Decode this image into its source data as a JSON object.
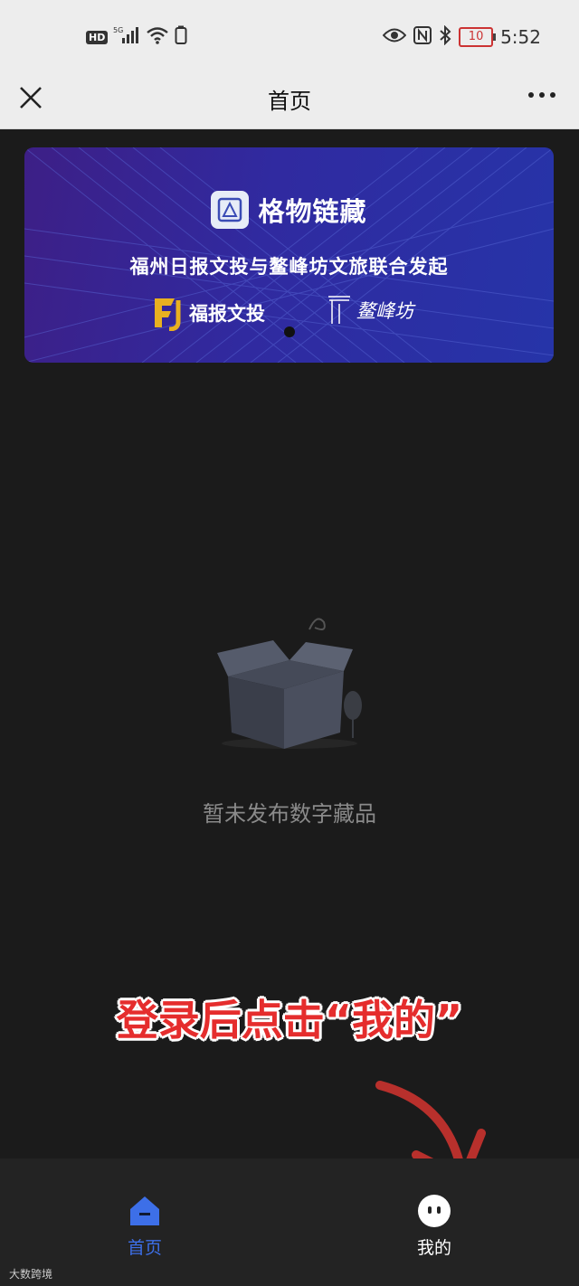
{
  "status_bar": {
    "hd_label": "HD",
    "network_label": "5G",
    "battery": "10",
    "time": "5:52"
  },
  "nav": {
    "title": "首页"
  },
  "banner": {
    "brand_name": "格物链藏",
    "subtitle": "福州日报文投与鳌峰坊文旅联合发起",
    "partner_1": "福报文投",
    "partner_2": "鳌峰坊"
  },
  "empty_state": {
    "text": "暂未发布数字藏品"
  },
  "annotation": {
    "text": "登录后点击“我的”"
  },
  "tabbar": {
    "items": [
      {
        "label": "首页",
        "icon": "home-icon",
        "active": true
      },
      {
        "label": "我的",
        "icon": "profile-icon",
        "active": false
      }
    ]
  },
  "watermark": "大数跨境",
  "colors": {
    "accent": "#3d6fe8",
    "annotation": "#e52d2d",
    "background": "#1b1b1b"
  }
}
